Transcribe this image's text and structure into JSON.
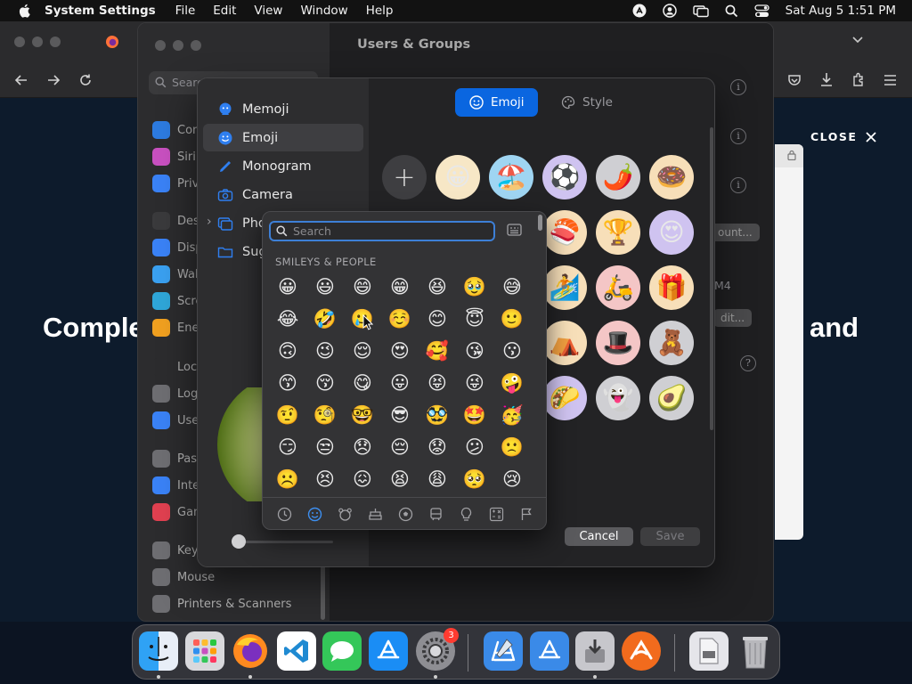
{
  "menubar": {
    "app_name": "System Settings",
    "menus": [
      "File",
      "Edit",
      "View",
      "Window",
      "Help"
    ],
    "clock": "Sat Aug 5  1:51 PM"
  },
  "browser": {
    "hero_left": "Comple",
    "hero_right": "and",
    "close_label": "CLOSE"
  },
  "settings": {
    "title": "Users & Groups",
    "search_placeholder": "Search",
    "sidebar": [
      {
        "label": "Con",
        "color": "#2d7be0"
      },
      {
        "label": "Siri",
        "color": "#c850c0"
      },
      {
        "label": "Priva",
        "color": "#3a82f6"
      },
      {
        "label": "Des",
        "color": "#3a3a3c"
      },
      {
        "label": "Disp",
        "color": "#3a82f6"
      },
      {
        "label": "Wall",
        "color": "#3aa0f0"
      },
      {
        "label": "Scre",
        "color": "#2fa6d8"
      },
      {
        "label": "Ener",
        "color": "#f0a020"
      },
      {
        "label": "Lock",
        "color": "#2c2c2e"
      },
      {
        "label": "Logi",
        "color": "#6e6e72"
      },
      {
        "label": "Use",
        "color": "#3a82f6"
      },
      {
        "label": "Pass",
        "color": "#6e6e72"
      },
      {
        "label": "Inte",
        "color": "#3a82f6"
      },
      {
        "label": "Gam",
        "color": "#e04050"
      },
      {
        "label": "Keyl",
        "color": "#6e6e72"
      },
      {
        "label": "Mouse",
        "color": "#6e6e72"
      },
      {
        "label": "Printers & Scanners",
        "color": "#6e6e72"
      }
    ],
    "ghost_btn_1": "ount...",
    "ghost_btn_2": "dit...",
    "ghost_val": "M4"
  },
  "dialog": {
    "sidebar": [
      {
        "label": "Memoji",
        "icon": "memoji-icon"
      },
      {
        "label": "Emoji",
        "icon": "emoji-icon",
        "selected": true
      },
      {
        "label": "Monogram",
        "icon": "pencil-icon"
      },
      {
        "label": "Camera",
        "icon": "camera-icon"
      },
      {
        "label": "Pho",
        "icon": "photos-icon"
      },
      {
        "label": "Sug",
        "icon": "folder-icon"
      }
    ],
    "tab_emoji": "Emoji",
    "tab_style": "Style",
    "cancel": "Cancel",
    "save": "Save",
    "circles": [
      {
        "e": "😀",
        "bg": "#f7e7c6"
      },
      {
        "e": "🏖️",
        "bg": "#9fd5f2"
      },
      {
        "e": "⚽",
        "bg": "#cfc3f0"
      },
      {
        "e": "🌶️",
        "bg": "#cfcfd3"
      },
      {
        "e": "🍩",
        "bg": "#f7dfb9"
      },
      {
        "e": "🍣",
        "bg": "#f7dfb9"
      },
      {
        "e": "🏆",
        "bg": "#f7dfb9"
      },
      {
        "e": "😍",
        "bg": "#cfc3f0"
      },
      {
        "e": "🏄",
        "bg": "#f7dfb9"
      },
      {
        "e": "🛵",
        "bg": "#f4c6c6"
      },
      {
        "e": "🎁",
        "bg": "#f7dfb9"
      },
      {
        "e": "⛺",
        "bg": "#f7dfb9"
      },
      {
        "e": "🎩",
        "bg": "#f4c6c6"
      },
      {
        "e": "🧸",
        "bg": "#cfcfd3"
      },
      {
        "e": "🌮",
        "bg": "#cfc3f0"
      },
      {
        "e": "👻",
        "bg": "#cfcfd3"
      },
      {
        "e": "🥑",
        "bg": "#cfcfd3"
      },
      {
        "e": "🚗",
        "bg": "#9fd5f2"
      },
      {
        "e": "🦋",
        "bg": "#f7dfb9"
      },
      {
        "e": "🔥",
        "bg": "#f4c6c6"
      }
    ]
  },
  "picker": {
    "search_placeholder": "Search",
    "section": "SMILEYS & PEOPLE",
    "emojis": [
      "😀",
      "😃",
      "😄",
      "😁",
      "😆",
      "🥹",
      "😅",
      "😂",
      "🤣",
      "🥲",
      "☺️",
      "😊",
      "😇",
      "🙂",
      "🙃",
      "😉",
      "😌",
      "😍",
      "🥰",
      "😘",
      "😗",
      "😙",
      "😚",
      "😋",
      "😛",
      "😝",
      "😜",
      "🤪",
      "🤨",
      "🧐",
      "🤓",
      "😎",
      "🥸",
      "🤩",
      "🥳",
      "😏",
      "😒",
      "😞",
      "😔",
      "😟",
      "😕",
      "🙁",
      "☹️",
      "😣",
      "😖",
      "😫",
      "😩",
      "🥺",
      "😢"
    ],
    "categories": [
      "recent-icon",
      "smileys-icon",
      "animals-icon",
      "food-icon",
      "activity-icon",
      "travel-icon",
      "objects-icon",
      "symbols-icon",
      "flags-icon"
    ]
  },
  "dock": {
    "badge": "3"
  }
}
